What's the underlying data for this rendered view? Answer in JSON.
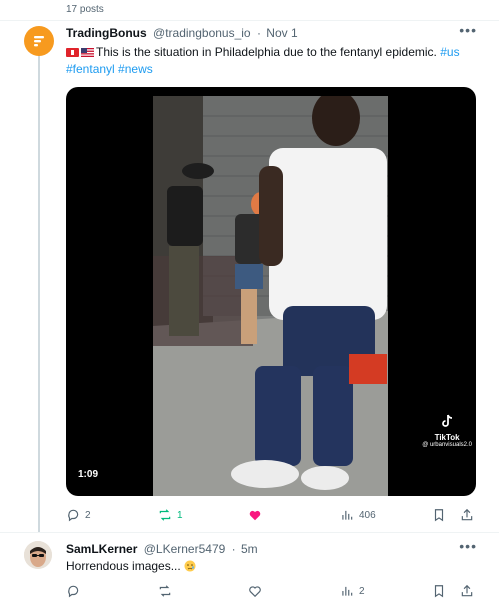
{
  "thread": {
    "posts_count": "17 posts"
  },
  "post": {
    "author_name": "TradingBonus",
    "author_handle": "@tradingbonus_io",
    "separator": "·",
    "date": "Nov 1",
    "text": "This is the situation in Philadelphia due to the fentanyl epidemic.",
    "hashtags": [
      "#us",
      "#fentanyl",
      "#news"
    ],
    "video": {
      "duration": "1:09",
      "watermark_brand": "TikTok",
      "watermark_user": "@ urbanvisuals2.0"
    },
    "stats": {
      "replies": "2",
      "reposts": "1",
      "likes": "",
      "views": "406"
    },
    "colors": {
      "repost_active": "#00ba7c",
      "like_active": "#f91880",
      "link": "#1d9bf0",
      "avatar": "#f79a1f"
    }
  },
  "reply": {
    "author_name": "SamLKerner",
    "author_handle": "@LKerner5479",
    "separator": "·",
    "date": "5m",
    "text": "Horrendous images...",
    "stats": {
      "replies": "",
      "reposts": "",
      "likes": "",
      "views": "2"
    }
  }
}
